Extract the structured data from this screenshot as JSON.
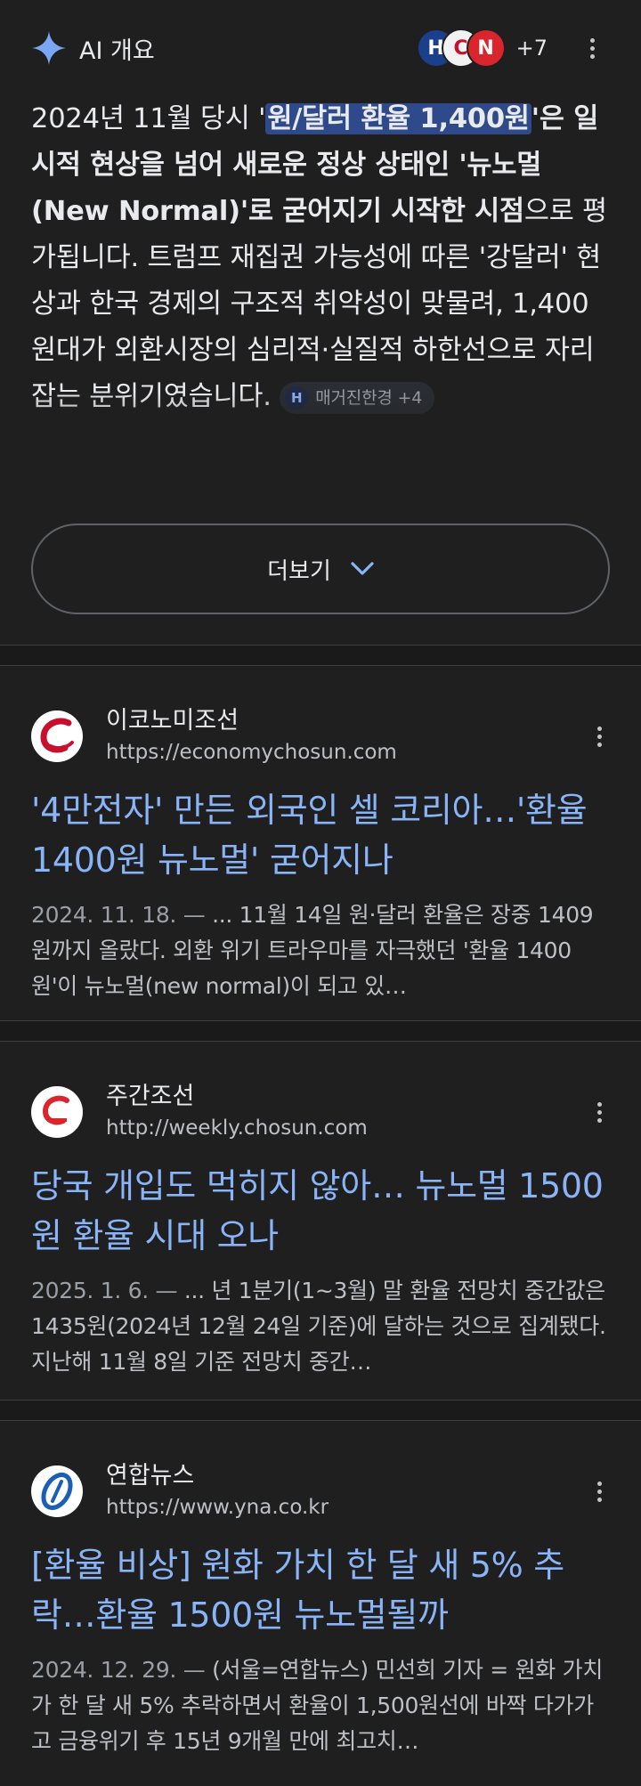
{
  "ai_overview": {
    "title": "AI 개요",
    "source_logos": [
      "H",
      "C",
      "N"
    ],
    "source_more": "+7",
    "text_1": "2024년 11월 당시 '",
    "highlight": "원/달러 환율 1,400원",
    "text_2": "'은 ",
    "bold_1": "일시적 현상을 넘어 새로운 정상 상태인 '뉴노멀(New Normal)'로 굳어지기 시작한 시점",
    "text_3": "으로 평가됩니다. 트럼프 재집권 가능성에 따른 '강달러' 현상과 한국 경제의 구조적 취약성이 맞물려, 1,400원대가 외환시장의 심리적·실질적 하한선으로 자리 잡는 분위기였습니다.",
    "cite_icon": "H",
    "cite_label": "매거진한경 +4",
    "more_button": "더보기"
  },
  "results": [
    {
      "site_name": "이코노미조선",
      "url": "https://economychosun.com",
      "title": "'4만전자' 만든 외국인 셀 코리아…'환율 1400원 뉴노멀' 굳어지나",
      "date": "2024. 11. 18. —",
      "snippet": " ... 11월 14일 원·달러 환율은 장중 1409원까지 올랐다. 외환 위기 트라우마를 자극했던 '환율 1400원'이 뉴노멀(new normal)이 되고 있…"
    },
    {
      "site_name": "주간조선",
      "url": "http://weekly.chosun.com",
      "title": "당국 개입도 먹히지 않아… 뉴노멀 1500원 환율 시대 오나",
      "date": "2025. 1. 6. —",
      "snippet": " ... 년 1분기(1~3월) 말 환율 전망치 중간값은 1435원(2024년 12월 24일 기준)에 달하는 것으로 집계됐다. 지난해 11월 8일 기준 전망치 중간…"
    },
    {
      "site_name": "연합뉴스",
      "url": "https://www.yna.co.kr",
      "title": "[환율 비상] 원화 가치 한 달 새 5% 추락…환율 1500원 뉴노멀될까",
      "date": "2024. 12. 29. —",
      "snippet": " (서울=연합뉴스) 민선희 기자 = 원화 가치가 한 달 새 5% 추락하면서 환율이 1,500원선에 바짝 다가가고 금융위기 후 15년 9개월 만에 최고치…"
    }
  ],
  "colors": {
    "background": "#1f1f1f",
    "link": "#8ab4f8",
    "highlight": "#2e4a8a",
    "ai_sparkle": "#8ab4f8"
  }
}
